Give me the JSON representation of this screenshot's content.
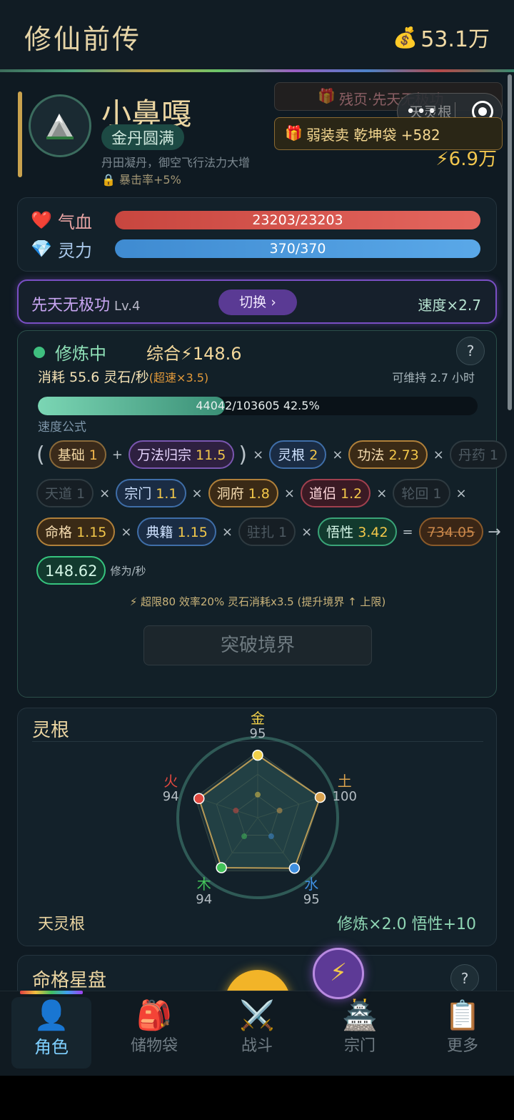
{
  "header": {
    "title": "修仙前传",
    "money_icon": "money-bag-icon",
    "money": "53.1万"
  },
  "profile": {
    "name": "小鼻嘎",
    "realm": "金丹圆满",
    "description": "丹田凝丹，御空飞行法力大增",
    "bonus": "暴击率+5%",
    "banner_faded": "残页·先天无极功",
    "capsule_text": "天灵根",
    "gift_banner": "弱装卖 乾坤袋 +582",
    "power": "⚡6.9万"
  },
  "stats": {
    "hp_label": "气血",
    "hp_value": "23203/23203",
    "hp_fraction": 1.0,
    "mp_label": "灵力",
    "mp_value": "370/370",
    "mp_fraction": 1.0
  },
  "technique": {
    "name": "先天无极功",
    "level": "Lv.4",
    "switch_label": "切换 ›",
    "speed": "速度×2.7"
  },
  "cultivation": {
    "status": "修炼中",
    "total": "综合⚡148.6",
    "consume": "消耗 55.6 灵石/秒",
    "overspeed": "(超速×3.5)",
    "sustain": "可维持 2.7 小时",
    "progress_text": "44042/103605  42.5%",
    "progress_fraction": 0.425,
    "formula_label": "速度公式",
    "formula": {
      "base_label": "基础",
      "base_val": "1",
      "wanfa_label": "万法归宗",
      "wanfa_val": "11.5",
      "root_label": "灵根",
      "root_val": "2",
      "gongfa_label": "功法",
      "gongfa_val": "2.73",
      "pill_label": "丹药 1",
      "tiandao_label": "天道 1",
      "sect_label": "宗门",
      "sect_val": "1.1",
      "cave_label": "洞府",
      "cave_val": "1.8",
      "partner_label": "道侣",
      "partner_val": "1.2",
      "reincarnation_label": "轮回 1",
      "fate_label": "命格",
      "fate_val": "1.15",
      "classic_label": "典籍",
      "classic_val": "1.15",
      "station_label": "驻扎 1",
      "wisdom_label": "悟性",
      "wisdom_val": "3.42",
      "capped_value": "734.05",
      "result": "148.62",
      "unit": "修为/秒"
    },
    "overlimit_note": "⚡ 超限80 效率20% 灵石消耗x3.5 (提升境界 ↑ 上限)",
    "breakthrough": "突破境界"
  },
  "spirit_root": {
    "title": "灵根",
    "elements": [
      {
        "name": "金",
        "value": 95,
        "color": "#f2d04a"
      },
      {
        "name": "土",
        "value": 100,
        "color": "#d9a24e"
      },
      {
        "name": "水",
        "value": 95,
        "color": "#3f8fe0"
      },
      {
        "name": "木",
        "value": 94,
        "color": "#43c35a"
      },
      {
        "name": "火",
        "value": 94,
        "color": "#e0483f"
      }
    ],
    "type": "天灵根",
    "bonus": "修炼×2.0  悟性+10"
  },
  "destiny": {
    "title": "命格星盘",
    "help": "?"
  },
  "nav": {
    "tabs": [
      {
        "label": "角色",
        "icon": "character-icon"
      },
      {
        "label": "储物袋",
        "icon": "backpack-icon"
      },
      {
        "label": "战斗",
        "icon": "crossed-swords-icon"
      },
      {
        "label": "宗门",
        "icon": "pagoda-icon"
      },
      {
        "label": "更多",
        "icon": "clipboard-icon"
      }
    ]
  }
}
